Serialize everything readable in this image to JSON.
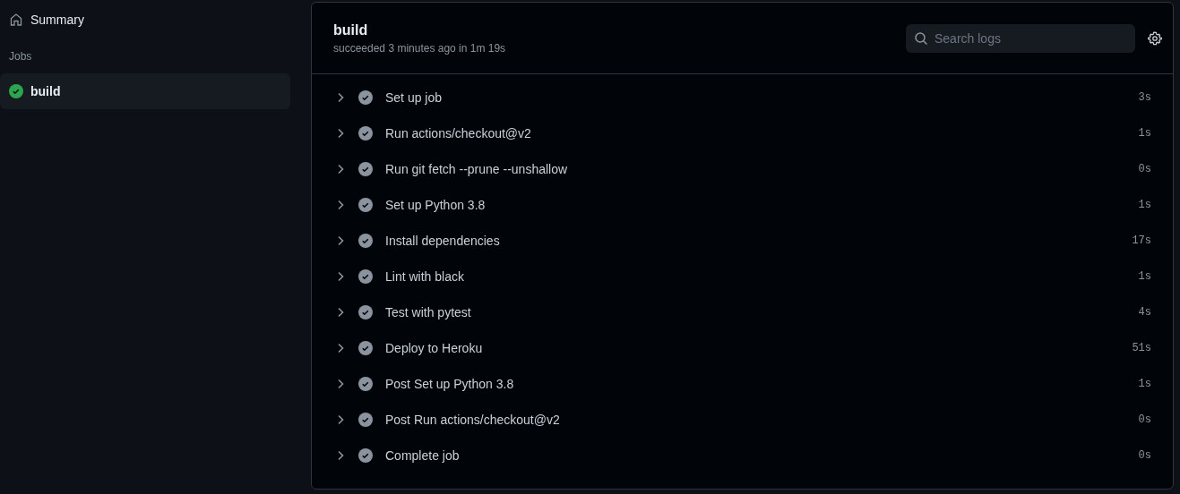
{
  "sidebar": {
    "summary": {
      "label": "Summary",
      "selected": false
    },
    "jobs_heading": "Jobs",
    "jobs": [
      {
        "label": "build",
        "selected": true,
        "succeeded": true
      }
    ]
  },
  "job": {
    "title": "build",
    "subtitle": "succeeded 3 minutes ago in 1m 19s",
    "search": {
      "placeholder": "Search logs"
    },
    "steps": [
      {
        "name": "Set up job",
        "duration": "3s",
        "expanded": false
      },
      {
        "name": "Run actions/checkout@v2",
        "duration": "1s",
        "expanded": false
      },
      {
        "name": "Run git fetch --prune --unshallow",
        "duration": "0s",
        "expanded": false
      },
      {
        "name": "Set up Python 3.8",
        "duration": "1s",
        "expanded": false
      },
      {
        "name": "Install dependencies",
        "duration": "17s",
        "expanded": false
      },
      {
        "name": "Lint with black",
        "duration": "1s",
        "expanded": false
      },
      {
        "name": "Test with pytest",
        "duration": "4s",
        "expanded": false
      },
      {
        "name": "Deploy to Heroku",
        "duration": "51s",
        "expanded": false
      },
      {
        "name": "Post Set up Python 3.8",
        "duration": "1s",
        "expanded": false
      },
      {
        "name": "Post Run actions/checkout@v2",
        "duration": "0s",
        "expanded": false
      },
      {
        "name": "Complete job",
        "duration": "0s",
        "expanded": false
      }
    ]
  }
}
